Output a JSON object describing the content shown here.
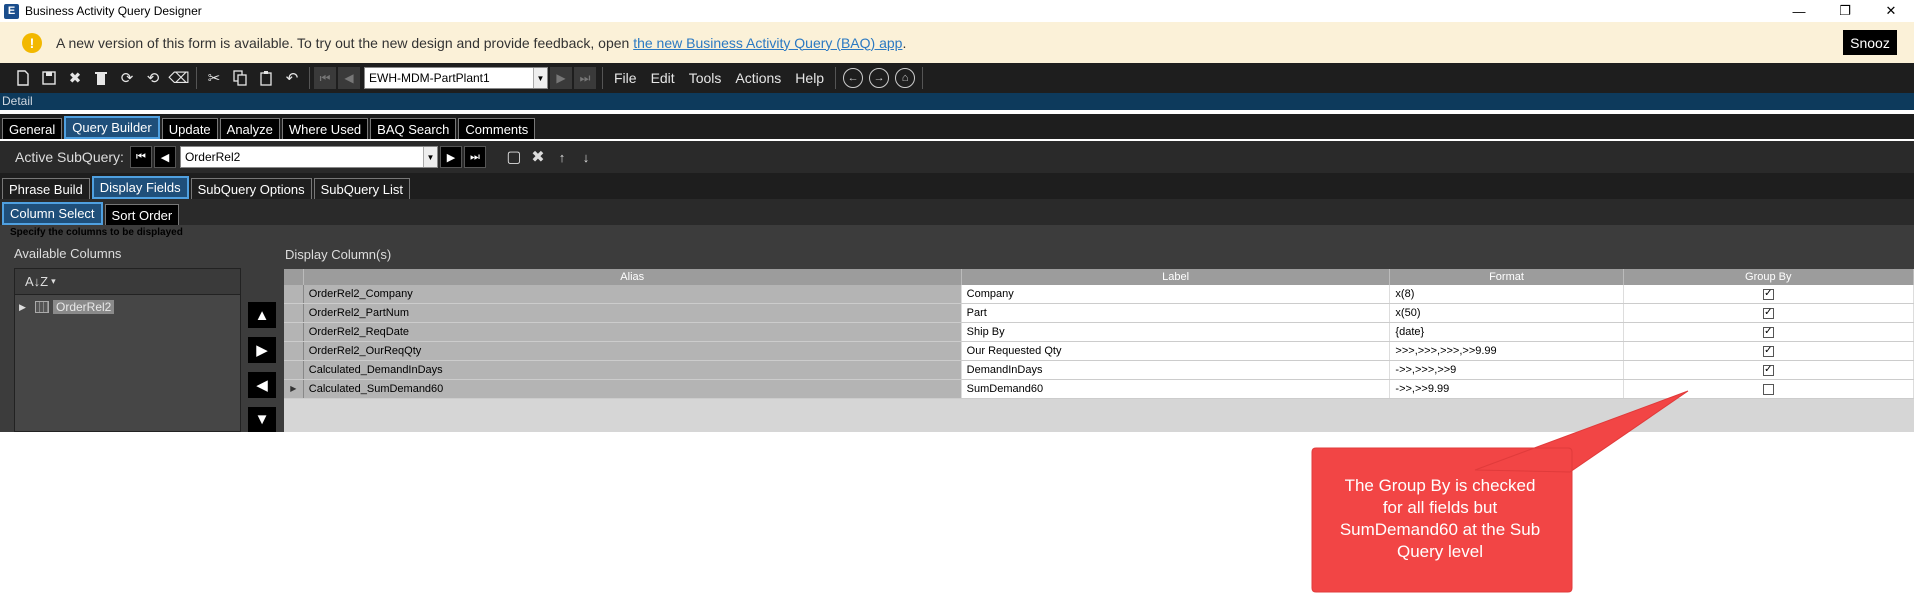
{
  "window": {
    "title": "Business Activity Query Designer",
    "minimize": "—",
    "restore": "❐",
    "close": "✕"
  },
  "notice": {
    "icon": "!",
    "text": "A new version of this form is available. To try out the new design and provide feedback, open ",
    "link": "the new Business Activity Query (BAQ) app",
    "suffix": ".",
    "snooze": "Snooz"
  },
  "toolbar": {
    "query_id": "EWH-MDM-PartPlant1",
    "menus": [
      "File",
      "Edit",
      "Tools",
      "Actions",
      "Help"
    ]
  },
  "detail": {
    "label": "Detail"
  },
  "main_tabs": [
    {
      "label": "General",
      "active": false
    },
    {
      "label": "Query Builder",
      "active": true
    },
    {
      "label": "Update",
      "active": false
    },
    {
      "label": "Analyze",
      "active": false
    },
    {
      "label": "Where Used",
      "active": false
    },
    {
      "label": "BAQ Search",
      "active": false
    },
    {
      "label": "Comments",
      "active": false
    }
  ],
  "subquery": {
    "label": "Active SubQuery:",
    "value": "OrderRel2"
  },
  "sub_tabs": [
    {
      "label": "Phrase Build",
      "active": false
    },
    {
      "label": "Display Fields",
      "active": true
    },
    {
      "label": "SubQuery Options",
      "active": false
    },
    {
      "label": "SubQuery List",
      "active": false
    }
  ],
  "field_tabs": [
    {
      "label": "Column Select",
      "active": true
    },
    {
      "label": "Sort Order",
      "active": false
    }
  ],
  "content": {
    "hint": "Specify the columns to be displayed",
    "available_label": "Available Columns",
    "display_label": "Display Column(s)",
    "tree_sort": "A↓Z",
    "tree_node": "OrderRel2"
  },
  "grid": {
    "columns": [
      "Alias",
      "Label",
      "Format",
      "Group By"
    ],
    "rows": [
      {
        "alias": "OrderRel2_Company",
        "label": "Company",
        "format": "x(8)",
        "group_by": true,
        "current": false
      },
      {
        "alias": "OrderRel2_PartNum",
        "label": "Part",
        "format": "x(50)",
        "group_by": true,
        "current": false
      },
      {
        "alias": "OrderRel2_ReqDate",
        "label": "Ship By",
        "format": "{date}",
        "group_by": true,
        "current": false
      },
      {
        "alias": "OrderRel2_OurReqQty",
        "label": "Our Requested Qty",
        "format": ">>>,>>>,>>>,>>9.99",
        "group_by": true,
        "current": false
      },
      {
        "alias": "Calculated_DemandInDays",
        "label": "DemandInDays",
        "format": "->>,>>>,>>9",
        "group_by": true,
        "current": false
      },
      {
        "alias": "Calculated_SumDemand60",
        "label": "SumDemand60",
        "format": "->>,>>9.99",
        "group_by": false,
        "current": true
      }
    ]
  },
  "callout": {
    "color": "#f24545",
    "lines": [
      "The Group By is checked",
      "for all fields but",
      "SumDemand60 at the Sub",
      "Query level"
    ]
  }
}
